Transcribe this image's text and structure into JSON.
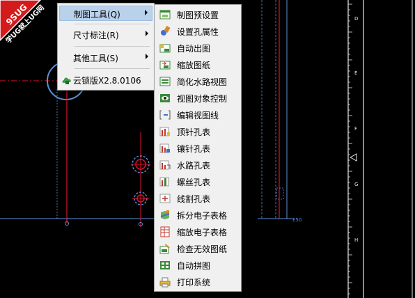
{
  "badge": {
    "line1": "9SUG",
    "line2": "学UG就上UG网"
  },
  "main_menu": [
    {
      "label": "制图工具(Q)",
      "highlighted": true,
      "has_submenu": true
    },
    {
      "label": "尺寸标注(R)",
      "highlighted": false,
      "has_submenu": true
    },
    {
      "label": "其他工具(S)",
      "highlighted": false,
      "has_submenu": true
    },
    {
      "label": "云锁版X2.8.0106",
      "highlighted": false,
      "has_submenu": false,
      "icon": "cloud-lock-icon"
    }
  ],
  "sub_menu": [
    {
      "label": "制图预设置",
      "icon": "drawing-preset-icon"
    },
    {
      "label": "设置孔属性",
      "icon": "hole-attribute-icon"
    },
    {
      "label": "自动出图",
      "icon": "auto-drawing-icon"
    },
    {
      "label": "缩放图纸",
      "icon": "scale-drawing-icon"
    },
    {
      "label": "简化水路视图",
      "icon": "water-view-icon"
    },
    {
      "label": "视图对象控制",
      "icon": "view-object-icon"
    },
    {
      "label": "编辑视图线",
      "icon": "edit-view-line-icon"
    },
    {
      "label": "顶针孔表",
      "icon": "ejector-table-icon"
    },
    {
      "label": "镶针孔表",
      "icon": "insert-pin-table-icon"
    },
    {
      "label": "水路孔表",
      "icon": "water-hole-table-icon"
    },
    {
      "label": "螺丝孔表",
      "icon": "screw-hole-table-icon"
    },
    {
      "label": "线割孔表",
      "icon": "wire-cut-table-icon"
    },
    {
      "label": "拆分电子表格",
      "icon": "split-sheet-icon"
    },
    {
      "label": "缩放电子表格",
      "icon": "scale-sheet-icon"
    },
    {
      "label": "检查无效图纸",
      "icon": "check-drawing-icon"
    },
    {
      "label": "自动拼图",
      "icon": "auto-layout-icon"
    },
    {
      "label": "打印系统",
      "icon": "print-icon"
    }
  ],
  "ruler_labels": [
    "D",
    "E",
    "F",
    "G",
    "H"
  ],
  "canvas_labels": {
    "e50": "E50"
  },
  "colors": {
    "red": "#e0102a",
    "blue": "#5d8fd8",
    "white": "#e8e8e8",
    "badge": "#d41b1b"
  }
}
